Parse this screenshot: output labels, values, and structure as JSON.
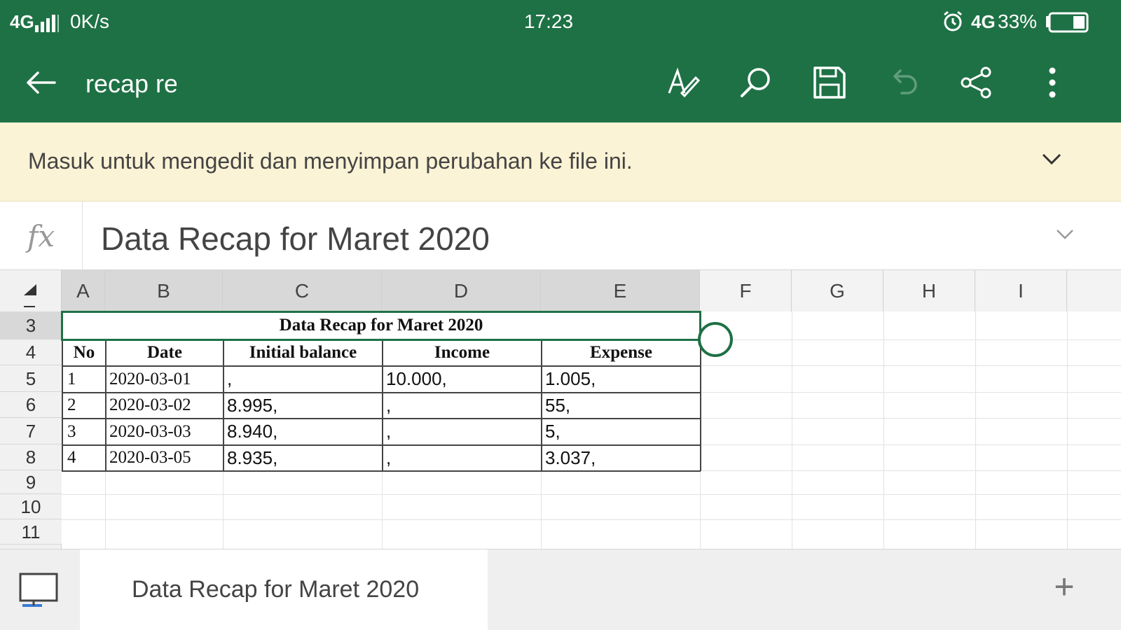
{
  "status_bar": {
    "network": "4G",
    "speed": "0K/s",
    "time": "17:23",
    "data_type": "4G",
    "battery": "33%",
    "battery_level": 0.33,
    "icons": [
      "signal-icon",
      "alarm-icon",
      "battery-icon"
    ]
  },
  "app_bar": {
    "title": "recap re",
    "icons": [
      "back-arrow-icon",
      "pen-icon",
      "search-icon",
      "save-icon",
      "undo-icon",
      "share-icon",
      "more-vertical-icon"
    ],
    "background": "#1e7145"
  },
  "banner": {
    "text": "Masuk untuk mengedit dan menyimpan perubahan ke file ini.",
    "background": "#fbf3d5"
  },
  "formula_bar": {
    "fx_label": "fx",
    "value": "Data Recap for Maret 2020"
  },
  "grid": {
    "columns": [
      "A",
      "B",
      "C",
      "D",
      "E",
      "F",
      "G",
      "H",
      "I"
    ],
    "rows": [
      "3",
      "4",
      "5",
      "6",
      "7",
      "8",
      "9",
      "10",
      "11"
    ],
    "selected_range": "A3:E3",
    "title_cell": "Data Recap for Maret 2020",
    "headers": [
      "No",
      "Date",
      "Initial balance",
      "Income",
      "Expense"
    ],
    "data_rows": [
      {
        "no": "1",
        "date": "2020-03-01",
        "initial": ",",
        "income": "10.000,",
        "expense": "1.005,"
      },
      {
        "no": "2",
        "date": "2020-03-02",
        "initial": "8.995,",
        "income": ",",
        "expense": "55,"
      },
      {
        "no": "3",
        "date": "2020-03-03",
        "initial": "8.940,",
        "income": ",",
        "expense": "5,"
      },
      {
        "no": "4",
        "date": "2020-03-05",
        "initial": "8.935,",
        "income": ",",
        "expense": "3.037,"
      }
    ],
    "accent": "#1e7145"
  },
  "sheet_bar": {
    "active_sheet": "Data Recap for Maret 2020",
    "add_label": "+",
    "icons": [
      "sheets-icon",
      "add-icon"
    ]
  }
}
